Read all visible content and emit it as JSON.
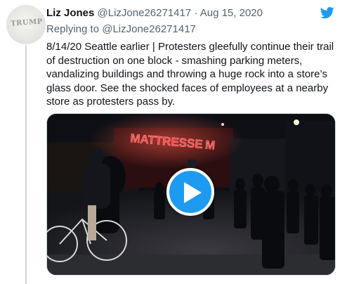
{
  "author": {
    "name": "Liz Jones",
    "handle": "@LizJone26271417",
    "separator": "·",
    "date": "Aug 15, 2020",
    "avatar_text": "TRUMP"
  },
  "reply": {
    "prefix": "Replying to",
    "mention": "@LizJone26271417"
  },
  "tweet_text": "8/14/20 Seattle earlier | Protesters gleefully continue their trail of destruction on one block - smashing parking meters, vandalizing buildings and throwing a huge rock into a store’s glass door. See the shocked faces of employees at a nearby store as protesters pass by.",
  "media": {
    "sign_text": "MATTRESSE M",
    "play_icon": "play-icon"
  },
  "colors": {
    "accent": "#1d9bf0",
    "secondary_text": "#536471",
    "sign_red": "#ff3b3b"
  }
}
